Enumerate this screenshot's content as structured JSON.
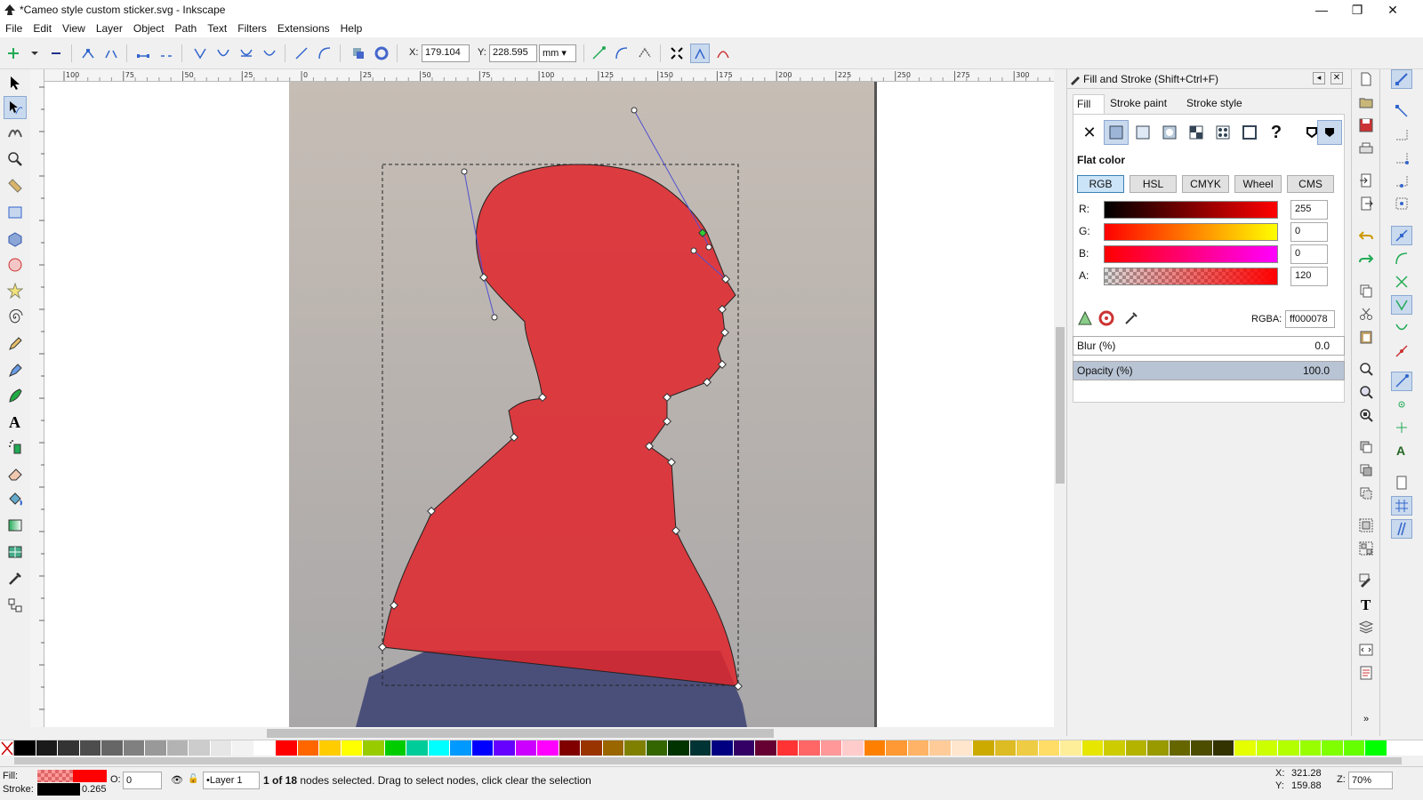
{
  "window": {
    "title": "*Cameo style custom sticker.svg - Inkscape",
    "minimize": "—",
    "restore": "❐",
    "close": "✕"
  },
  "menu": [
    "File",
    "Edit",
    "View",
    "Layer",
    "Object",
    "Path",
    "Text",
    "Filters",
    "Extensions",
    "Help"
  ],
  "tool_controls": {
    "x_label": "X:",
    "x_value": "179.104",
    "y_label": "Y:",
    "y_value": "228.595",
    "unit": "mm"
  },
  "ruler_labels": [
    "100",
    "75",
    "50",
    "25",
    "0",
    "25",
    "50",
    "75",
    "100",
    "125",
    "150",
    "175",
    "200",
    "225",
    "250",
    "275",
    "300"
  ],
  "fill_stroke": {
    "title": "Fill and Stroke (Shift+Ctrl+F)",
    "tabs": [
      "Fill",
      "Stroke paint",
      "Stroke style"
    ],
    "paint_label": "Flat color",
    "modes": [
      "RGB",
      "HSL",
      "CMYK",
      "Wheel",
      "CMS"
    ],
    "channels": [
      {
        "label": "R:",
        "value": "255"
      },
      {
        "label": "G:",
        "value": "0"
      },
      {
        "label": "B:",
        "value": "0"
      },
      {
        "label": "A:",
        "value": "120"
      }
    ],
    "rgba_label": "RGBA:",
    "rgba_value": "ff000078",
    "blur_label": "Blur (%)",
    "blur_value": "0.0",
    "opacity_label": "Opacity (%)",
    "opacity_value": "100.0",
    "opacity_fraction": 1.0
  },
  "status": {
    "fill_label": "Fill:",
    "stroke_label": "Stroke:",
    "stroke_width": "0.265",
    "o_label": "O:",
    "o_value": "0",
    "layer": "•Layer 1",
    "message_bold": "1 of 18",
    "message": " nodes selected. Drag to select nodes, click clear the selection",
    "x_label": "X:",
    "x": "321.28",
    "y_label": "Y:",
    "y": "159.88",
    "z_label": "Z:",
    "zoom": "70%"
  },
  "colors": {
    "fill": "#ff0000",
    "accent": "#3c7fb1"
  },
  "palette": [
    "#000000",
    "#1a1a1a",
    "#333333",
    "#4d4d4d",
    "#666666",
    "#808080",
    "#999999",
    "#b3b3b3",
    "#cccccc",
    "#e6e6e6",
    "#f2f2f2",
    "#ffffff",
    "#ff0000",
    "#ff6600",
    "#ffcc00",
    "#ffff00",
    "#99cc00",
    "#00cc00",
    "#00cc99",
    "#00ffff",
    "#0099ff",
    "#0000ff",
    "#6600ff",
    "#cc00ff",
    "#ff00ff",
    "#800000",
    "#993300",
    "#996600",
    "#808000",
    "#336600",
    "#003300",
    "#003333",
    "#000080",
    "#330066",
    "#660033",
    "#ff3333",
    "#ff6666",
    "#ff9999",
    "#ffcccc",
    "#ff8000",
    "#ff9933",
    "#ffb366",
    "#ffcc99",
    "#ffe6cc",
    "#ccaa00",
    "#ddbb22",
    "#eecc44",
    "#ffdd66",
    "#ffee99",
    "#e6e600",
    "#cccc00",
    "#b3b300",
    "#999900",
    "#666600",
    "#4d4d00",
    "#333300",
    "#e5ff00",
    "#ccff00",
    "#b3ff00",
    "#99ff00",
    "#80ff00",
    "#66ff00",
    "#00ff00"
  ]
}
